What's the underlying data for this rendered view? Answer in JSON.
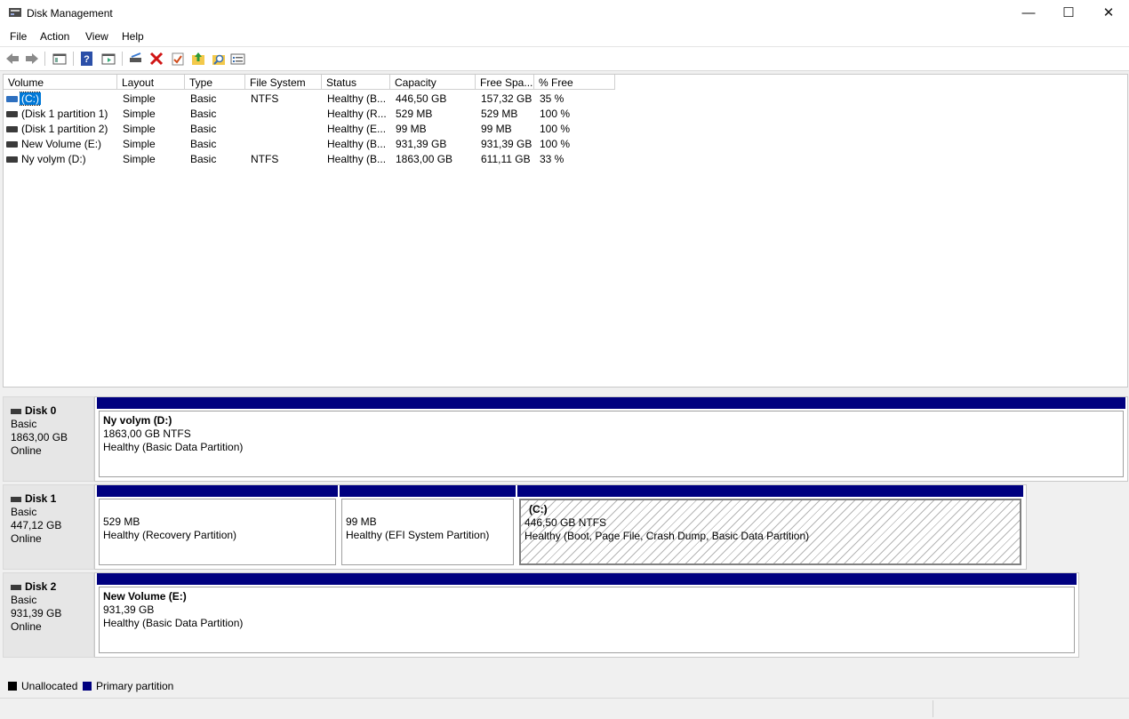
{
  "window": {
    "title": "Disk Management",
    "controls": {
      "minimize": "—",
      "maximize": "☐",
      "close": "✕"
    }
  },
  "menu": [
    "File",
    "Action",
    "View",
    "Help"
  ],
  "toolbar_icons": [
    "back-arrow-icon",
    "forward-arrow-icon",
    "show-hide-tree-icon",
    "help-icon",
    "properties-icon",
    "connect-drive-icon",
    "delete-icon",
    "check-icon",
    "folder-up-icon",
    "search-folder-icon",
    "list-view-icon"
  ],
  "volume_table": {
    "columns": [
      "Volume",
      "Layout",
      "Type",
      "File System",
      "Status",
      "Capacity",
      "Free Spa...",
      "% Free"
    ],
    "rows": [
      {
        "volume": "(C:)",
        "layout": "Simple",
        "type": "Basic",
        "fs": "NTFS",
        "status": "Healthy (B...",
        "capacity": "446,50 GB",
        "free": "157,32 GB",
        "pct": "35 %",
        "selected": true
      },
      {
        "volume": "(Disk 1 partition 1)",
        "layout": "Simple",
        "type": "Basic",
        "fs": "",
        "status": "Healthy (R...",
        "capacity": "529 MB",
        "free": "529 MB",
        "pct": "100 %",
        "selected": false
      },
      {
        "volume": "(Disk 1 partition 2)",
        "layout": "Simple",
        "type": "Basic",
        "fs": "",
        "status": "Healthy (E...",
        "capacity": "99 MB",
        "free": "99 MB",
        "pct": "100 %",
        "selected": false
      },
      {
        "volume": "New Volume (E:)",
        "layout": "Simple",
        "type": "Basic",
        "fs": "",
        "status": "Healthy (B...",
        "capacity": "931,39 GB",
        "free": "931,39 GB",
        "pct": "100 %",
        "selected": false
      },
      {
        "volume": "Ny volym (D:)",
        "layout": "Simple",
        "type": "Basic",
        "fs": "NTFS",
        "status": "Healthy (B...",
        "capacity": "1863,00 GB",
        "free": "611,11 GB",
        "pct": "33 %",
        "selected": false
      }
    ]
  },
  "disks": [
    {
      "name": "Disk 0",
      "type": "Basic",
      "size": "1863,00 GB",
      "state": "Online",
      "partitions": [
        {
          "name": "Ny volym  (D:)",
          "size": "1863,00 GB NTFS",
          "status": "Healthy (Basic Data Partition)",
          "hatched": false
        }
      ]
    },
    {
      "name": "Disk 1",
      "type": "Basic",
      "size": "447,12 GB",
      "state": "Online",
      "partitions": [
        {
          "name": "",
          "size": "529 MB",
          "status": "Healthy (Recovery Partition)",
          "hatched": false
        },
        {
          "name": "",
          "size": "99 MB",
          "status": "Healthy (EFI System Partition)",
          "hatched": false
        },
        {
          "name": "(C:)",
          "size": "446,50 GB NTFS",
          "status": "Healthy (Boot, Page File, Crash Dump, Basic Data Partition)",
          "hatched": true
        }
      ]
    },
    {
      "name": "Disk 2",
      "type": "Basic",
      "size": "931,39 GB",
      "state": "Online",
      "partitions": [
        {
          "name": "New Volume  (E:)",
          "size": "931,39 GB",
          "status": "Healthy (Basic Data Partition)",
          "hatched": false
        }
      ]
    }
  ],
  "legend": [
    {
      "label": "Unallocated",
      "color": "#000000"
    },
    {
      "label": "Primary partition",
      "color": "#00007f"
    }
  ],
  "colors": {
    "primary_partition": "#00007f",
    "selection": "#0078d7"
  }
}
